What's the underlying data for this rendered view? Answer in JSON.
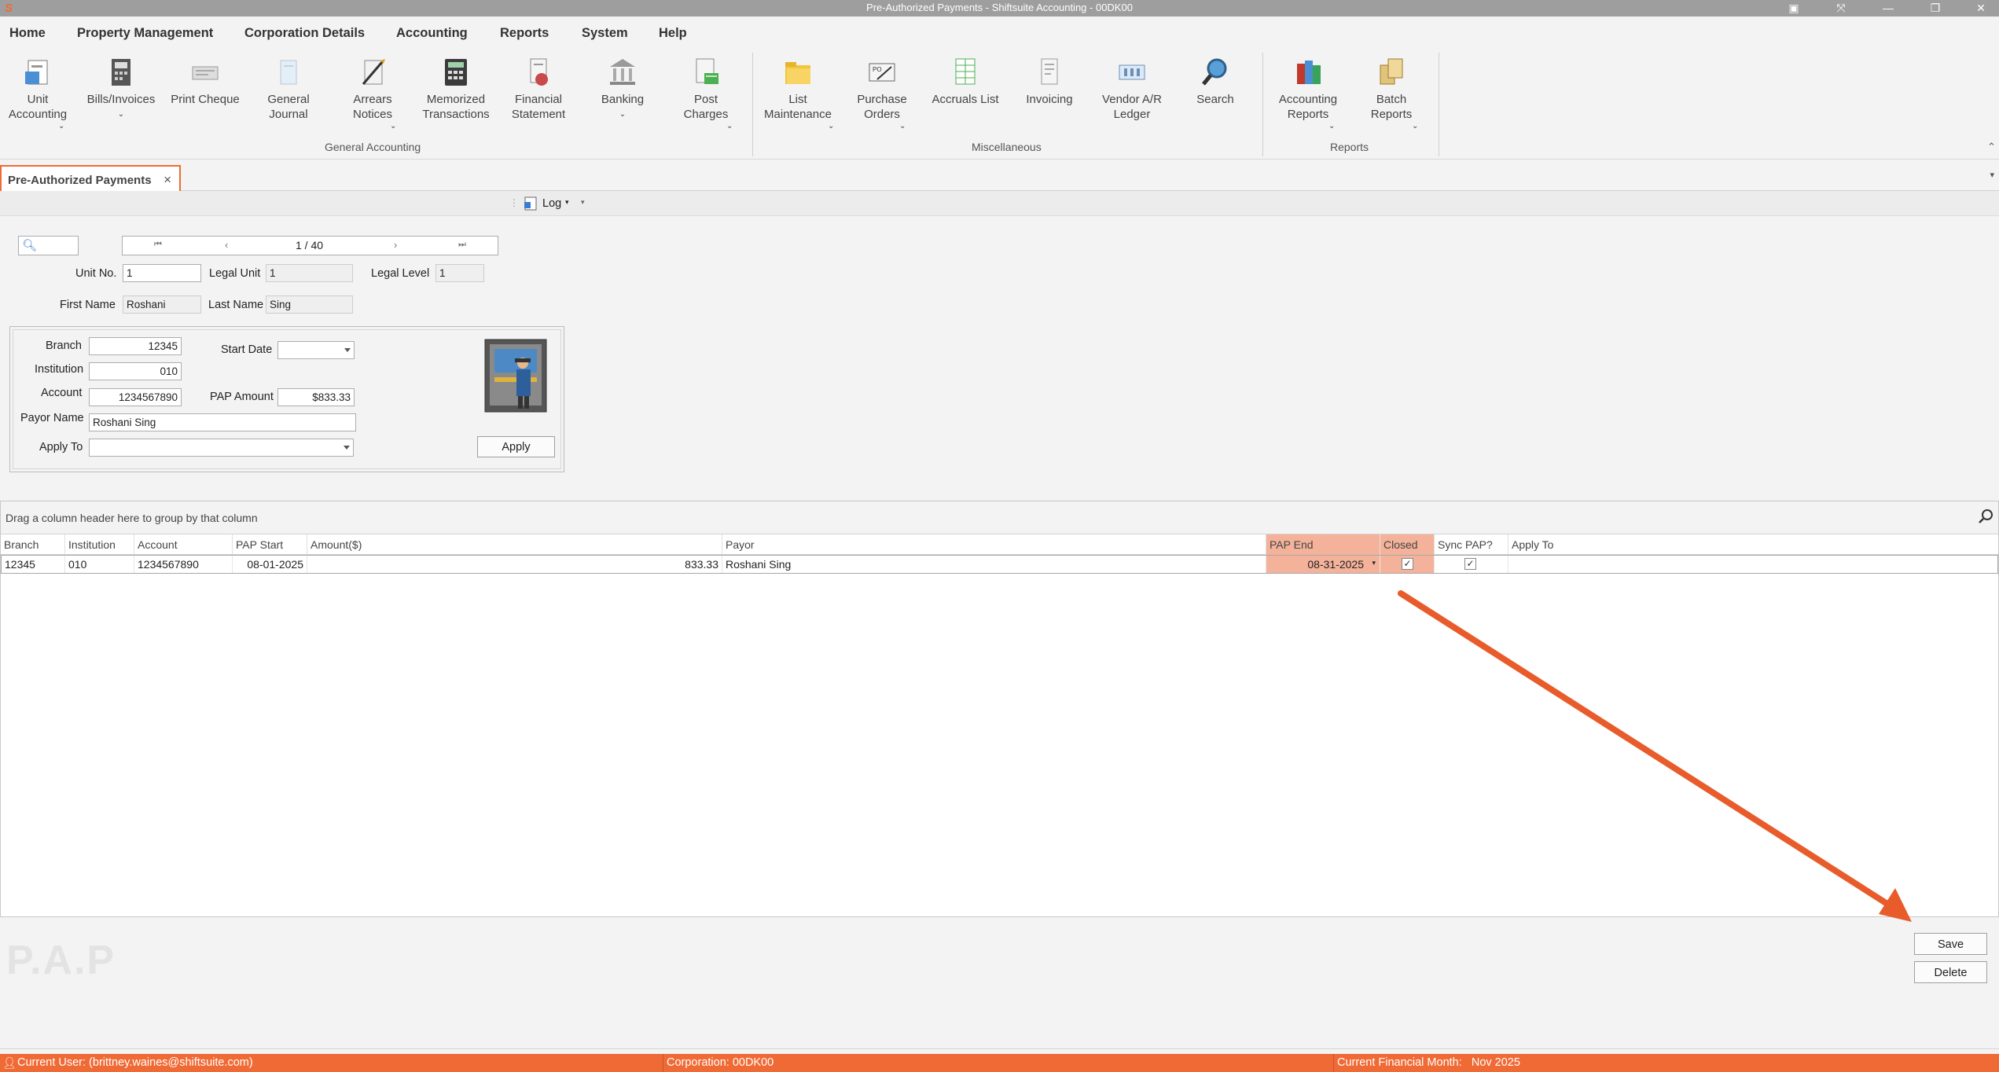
{
  "window": {
    "title": "Pre-Authorized Payments - Shiftsuite Accounting - 00DK00"
  },
  "menu": {
    "items": [
      "Home",
      "Property Management",
      "Corporation Details",
      "Accounting",
      "Reports",
      "System",
      "Help"
    ],
    "active": "Accounting"
  },
  "ribbon": {
    "buttons": {
      "unit_accounting": "Unit\nAccounting",
      "bills_invoices": "Bills/Invoices",
      "print_cheque": "Print Cheque",
      "general_journal": "General\nJournal",
      "arrears_notices": "Arrears\nNotices",
      "memorized_transactions": "Memorized\nTransactions",
      "financial_statement": "Financial\nStatement",
      "banking": "Banking",
      "post_charges": "Post\nCharges",
      "list_maintenance": "List\nMaintenance",
      "purchase_orders": "Purchase\nOrders",
      "accruals_list": "Accruals List",
      "invoicing": "Invoicing",
      "vendor_ar_ledger": "Vendor A/R\nLedger",
      "search": "Search",
      "accounting_reports": "Accounting\nReports",
      "batch_reports": "Batch\nReports"
    },
    "groups": {
      "general_accounting": "General Accounting",
      "miscellaneous": "Miscellaneous",
      "reports": "Reports"
    }
  },
  "doc_tab": {
    "label": "Pre-Authorized Payments",
    "close": "×"
  },
  "toolbar": {
    "log_label": "Log"
  },
  "navigator": {
    "position": "1 / 40"
  },
  "form": {
    "unit_no_label": "Unit No.",
    "unit_no": "1",
    "legal_unit_label": "Legal Unit",
    "legal_unit": "1",
    "legal_level_label": "Legal Level",
    "legal_level": "1",
    "first_name_label": "First Name",
    "first_name": "Roshani",
    "last_name_label": "Last Name",
    "last_name": "Sing",
    "branch_label": "Branch",
    "branch": "12345",
    "institution_label": "Institution",
    "institution": "010",
    "account_label": "Account",
    "account": "1234567890",
    "payor_name_label": "Payor Name",
    "payor_name": "Roshani Sing",
    "apply_to_label": "Apply To",
    "apply_to": "",
    "start_date_label": "Start Date",
    "start_date": "",
    "pap_amount_label": "PAP Amount",
    "pap_amount": "$833.33",
    "apply_button": "Apply"
  },
  "grid": {
    "group_hint": "Drag a column header here to group by that column",
    "columns": [
      "Branch",
      "Institution",
      "Account",
      "PAP Start",
      "Amount($)",
      "Payor",
      "PAP End",
      "Closed",
      "Sync PAP?",
      "Apply To"
    ],
    "rows": [
      {
        "branch": "12345",
        "institution": "010",
        "account": "1234567890",
        "pap_start": "08-01-2025",
        "amount": "833.33",
        "payor": "Roshani Sing",
        "pap_end": "08-31-2025",
        "closed": true,
        "sync_pap": true,
        "apply_to": ""
      }
    ]
  },
  "actions": {
    "save": "Save",
    "delete": "Delete"
  },
  "watermark": "P.A.P",
  "status": {
    "user": "Current User: (brittney.waines@shiftsuite.com)",
    "corporation": "Corporation: 00DK00",
    "financial_month": "Current Financial Month:   Nov 2025"
  },
  "colors": {
    "accent": "#f06a35",
    "highlight": "#f4b29a"
  }
}
